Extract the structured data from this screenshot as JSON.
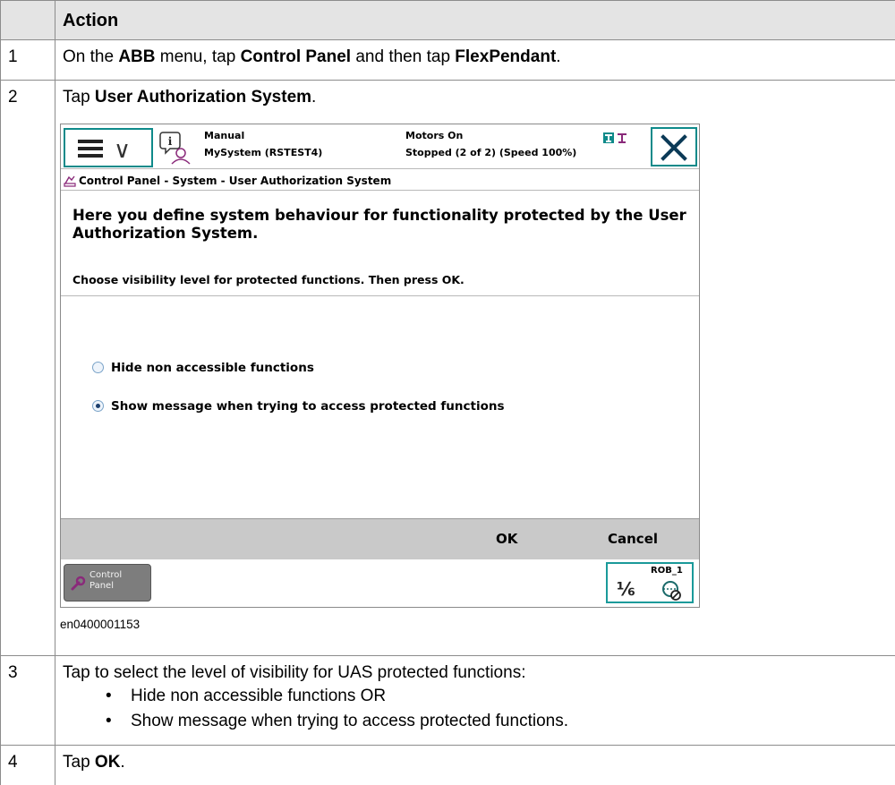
{
  "table": {
    "header": {
      "num": "",
      "action": "Action"
    },
    "steps": [
      {
        "num": "1",
        "parts": [
          "On the ",
          "ABB",
          " menu, tap ",
          "Control Panel",
          " and then tap ",
          "FlexPendant",
          "."
        ]
      },
      {
        "num": "2",
        "parts": [
          "Tap ",
          "User Authorization System",
          "."
        ]
      },
      {
        "num": "3",
        "text": "Tap to select the level of visibility for UAS protected functions:",
        "bullets": [
          "Hide non accessible functions OR",
          "Show message when trying to access protected functions."
        ]
      },
      {
        "num": "4",
        "parts": [
          "Tap ",
          "OK",
          "."
        ]
      }
    ]
  },
  "screenshot": {
    "status": {
      "mode": "Manual",
      "system": "MySystem (RSTEST4)",
      "motors": "Motors On",
      "state": "Stopped (2 of 2) (Speed 100%)"
    },
    "breadcrumb": "Control Panel - System - User Authorization System",
    "description": "Here you define system behaviour for functionality protected by the User Authorization System.",
    "prompt": "Choose visibility level for protected functions. Then press OK.",
    "options": [
      {
        "label": "Hide non accessible functions",
        "selected": false
      },
      {
        "label": "Show message when trying to access protected functions",
        "selected": true
      }
    ],
    "ok_label": "OK",
    "cancel_label": "Cancel",
    "taskbar_item": "Control Panel",
    "robot_name": "ROB_1",
    "robot_fraction": "⅙",
    "icons": [
      "menu-icon",
      "info-icon",
      "close-icon",
      "control-panel-icon",
      "robot-status-icon"
    ]
  },
  "caption": "en0400001153",
  "colors": {
    "accent": "#0e8a8a",
    "header_bg": "#e4e4e4",
    "toolbar_bg": "#c9c9c9"
  }
}
